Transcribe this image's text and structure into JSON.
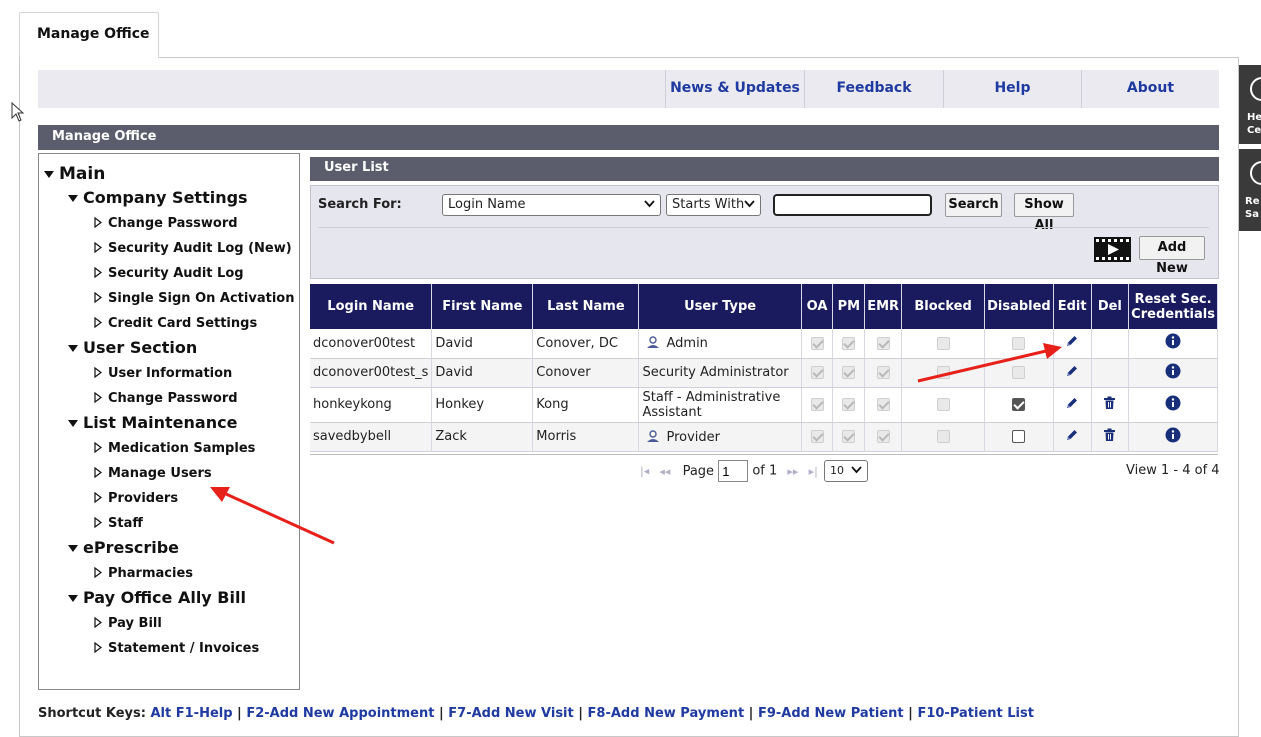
{
  "tab": {
    "label": "Manage Office"
  },
  "topnav": [
    "News & Updates",
    "Feedback",
    "Help",
    "About"
  ],
  "section_title": "Manage Office",
  "tree": [
    {
      "label": "Main",
      "level": 1
    },
    {
      "label": "Company Settings",
      "level": 2
    },
    {
      "label": "Change Password",
      "level": 3
    },
    {
      "label": "Security Audit Log (New)",
      "level": 3
    },
    {
      "label": "Security Audit Log",
      "level": 3
    },
    {
      "label": "Single Sign On Activation",
      "level": 3
    },
    {
      "label": "Credit Card Settings",
      "level": 3
    },
    {
      "label": "User Section",
      "level": 2
    },
    {
      "label": "User Information",
      "level": 3
    },
    {
      "label": "Change Password",
      "level": 3
    },
    {
      "label": "List Maintenance",
      "level": 2
    },
    {
      "label": "Medication Samples",
      "level": 3
    },
    {
      "label": "Manage Users",
      "level": 3
    },
    {
      "label": "Providers",
      "level": 3
    },
    {
      "label": "Staff",
      "level": 3
    },
    {
      "label": "ePrescribe",
      "level": 2
    },
    {
      "label": "Pharmacies",
      "level": 3
    },
    {
      "label": "Pay Office Ally Bill",
      "level": 2
    },
    {
      "label": "Pay Bill",
      "level": 3
    },
    {
      "label": "Statement / Invoices",
      "level": 3
    }
  ],
  "user_list": {
    "title": "User List",
    "search_label": "Search For:",
    "field_select": "Login Name",
    "match_select": "Starts With",
    "search_value": "",
    "search_button": "Search",
    "show_all_button": "Show All",
    "add_new_button": "Add New",
    "columns": [
      "Login Name",
      "First Name",
      "Last Name",
      "User Type",
      "OA",
      "PM",
      "EMR",
      "Blocked",
      "Disabled",
      "Edit",
      "Del",
      "Reset Sec. Credentials"
    ],
    "rows": [
      {
        "login": "dconover00test",
        "first": "David",
        "last": "Conover, DC",
        "type": "Admin",
        "type_icon": true,
        "oa": true,
        "pm": true,
        "emr": true,
        "blocked": false,
        "disabled": false,
        "disabled_editable": false,
        "del": false
      },
      {
        "login": "dconover00test_s",
        "first": "David",
        "last": "Conover",
        "type": "Security Administrator",
        "type_icon": false,
        "oa": true,
        "pm": true,
        "emr": true,
        "blocked": false,
        "disabled": false,
        "disabled_editable": false,
        "del": false
      },
      {
        "login": "honkeykong",
        "first": "Honkey",
        "last": "Kong",
        "type": "Staff - Administrative Assistant",
        "type_icon": false,
        "oa": true,
        "pm": true,
        "emr": true,
        "blocked": false,
        "disabled": true,
        "disabled_editable": true,
        "del": true
      },
      {
        "login": "savedbybell",
        "first": "Zack",
        "last": "Morris",
        "type": "Provider",
        "type_icon": true,
        "oa": true,
        "pm": true,
        "emr": true,
        "blocked": false,
        "disabled": false,
        "disabled_editable": true,
        "del": true
      }
    ],
    "pager": {
      "page_label": "Page",
      "page": "1",
      "of_label": "of 1",
      "page_size": "10",
      "view_text": "View 1 - 4 of 4"
    }
  },
  "shortcuts": {
    "label": "Shortcut Keys:",
    "items": [
      "Alt F1-Help",
      "F2-Add New Appointment",
      "F7-Add New Visit",
      "F8-Add New Payment",
      "F9-Add New Patient",
      "F10-Patient List"
    ]
  },
  "side_widgets": [
    "He Ce",
    "Re Sa"
  ],
  "colors": {
    "header_navy": "#1a1a5e",
    "bar_gray": "#5b5d6c",
    "link_blue": "#1f3aa0",
    "arrow_red": "#e8201a"
  }
}
